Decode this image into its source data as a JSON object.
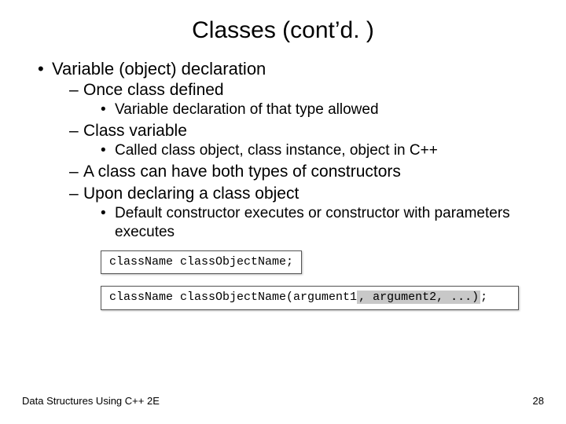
{
  "title": "Classes (cont’d. )",
  "bullets": {
    "l1_0": "Variable (object) declaration",
    "l2_0": "Once class defined",
    "l3_0": "Variable declaration of that type allowed",
    "l2_1": "Class variable",
    "l3_1": "Called class object, class instance, object in C++",
    "l2_2": "A class can have both types of constructors",
    "l2_3": "Upon declaring a class object",
    "l3_2": "Default constructor executes or constructor with parameters executes"
  },
  "code1": "className classObjectName;",
  "code2_a": "className classObjectName(argument1",
  "code2_b": ", argument2, ...)",
  "code2_c": ";",
  "footer_left": "Data Structures Using C++ 2E",
  "footer_right": "28"
}
